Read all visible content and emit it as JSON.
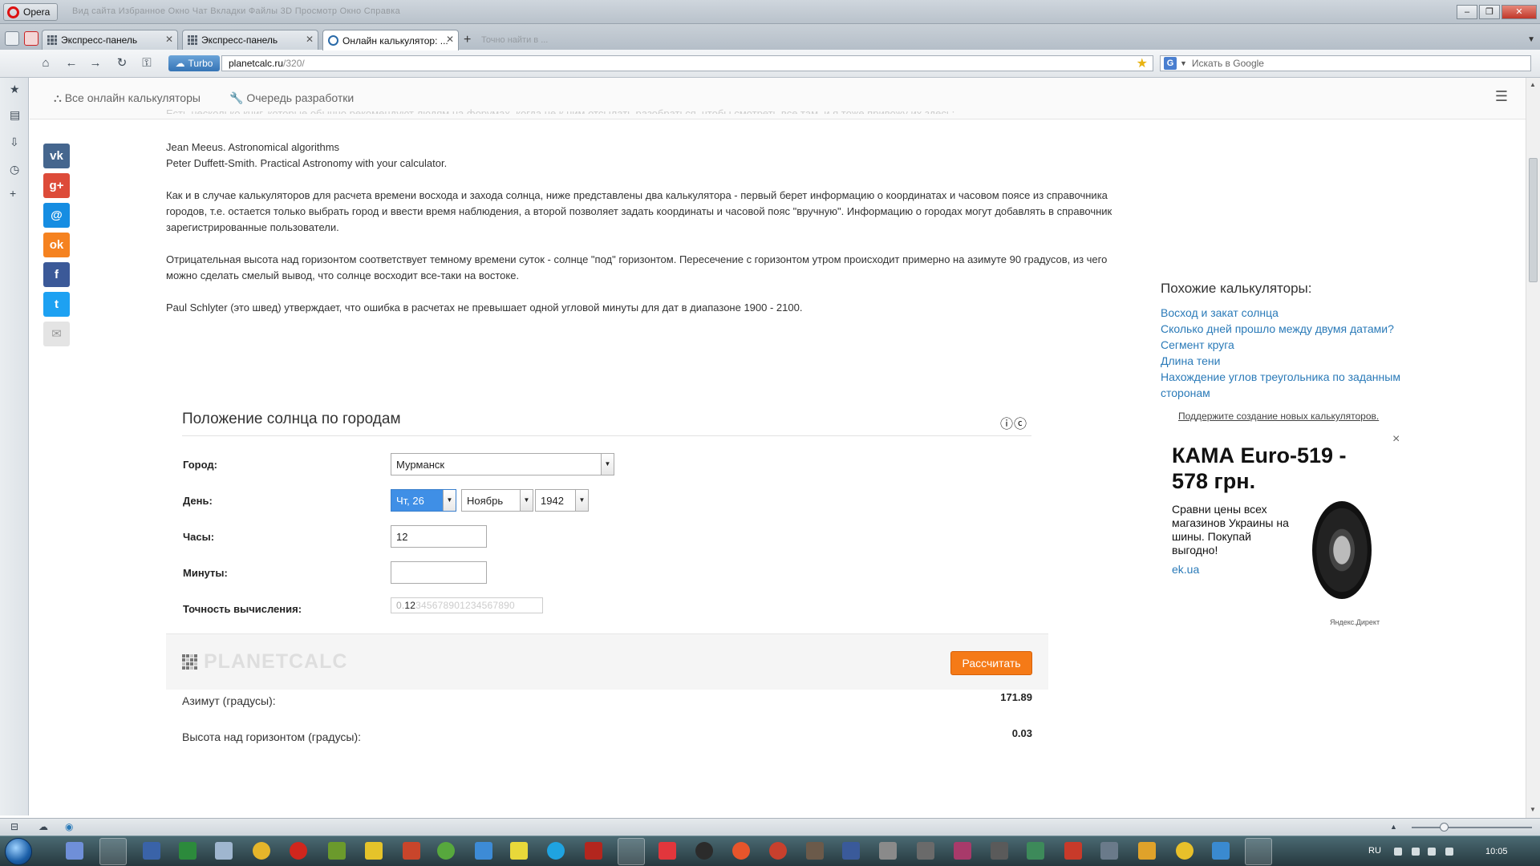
{
  "browser": {
    "menu_label": "Opera",
    "title_ghost": "Вид сайта   Избранное   Окно   Чат   Вкладки   Файлы   3D   Просмотр   Окно   Справка",
    "tabs": [
      {
        "label": "Экспресс-панель"
      },
      {
        "label": "Экспресс-панель"
      },
      {
        "label": "Онлайн калькулятор: ..."
      }
    ],
    "tab_ghost": "Точно найти в ...",
    "turbo_label": "Turbo",
    "address": {
      "host": "planetcalc.ru",
      "path": "/320/"
    },
    "search_placeholder": "Искать в Google",
    "search_engine": "G"
  },
  "site": {
    "nav": [
      {
        "label": "Все онлайн калькуляторы",
        "icon": "sitemap-icon"
      },
      {
        "label": "Очередь разработки",
        "icon": "wrench-icon"
      }
    ],
    "social": [
      {
        "name": "vk",
        "glyph": "vk",
        "color": "#45668e"
      },
      {
        "name": "google-plus",
        "glyph": "g+",
        "color": "#dd4b39"
      },
      {
        "name": "mailru",
        "glyph": "@",
        "color": "#168de2"
      },
      {
        "name": "odnoklassniki",
        "glyph": "ok",
        "color": "#f58220"
      },
      {
        "name": "facebook",
        "glyph": "f",
        "color": "#3b5998"
      },
      {
        "name": "twitter",
        "glyph": "t",
        "color": "#1da1f2"
      },
      {
        "name": "email",
        "glyph": "✉",
        "color": "#e4e4e4"
      }
    ]
  },
  "article": {
    "cut_line": "Есть несколько книг, которые обычно рекомендуют людям на форумах, когда не к ним отсылать разобраться, чтобы смотреть все там, и я тоже привожу их здесь:",
    "books": [
      "Jean Meeus. Astronomical algorithms",
      "Peter Duffett-Smith. Practical Astronomy with your calculator."
    ],
    "p1": "Как и в случае калькуляторов для расчета времени восхода и захода солнца, ниже представлены два калькулятора - первый берет информацию о координатах и часовом поясе из справочника городов, т.е. остается только выбрать город и ввести время наблюдения, а второй позволяет задать координаты и часовой пояс \"вручную\". Информацию о городах могут добавлять в справочник зарегистрированные пользователи.",
    "p2": "Отрицательная высота над горизонтом соответствует темному времени суток - солнце \"под\" горизонтом. Пересечение с горизонтом утром происходит примерно на азимуте 90 градусов, из чего можно сделать смелый вывод, что солнце восходит все-таки на востоке.",
    "p3": "Paul Schlyter (это швед) утверждает, что ошибка в расчетах не превышает одной угловой минуты для дат в диапазоне 1900 - 2100."
  },
  "calculator": {
    "title": "Положение солнца по городам",
    "license_icons": "ⓘⓒ",
    "city_label": "Город:",
    "city_value": "Мурманск",
    "day_label": "День:",
    "day_value": "Чт, 26",
    "month_value": "Ноябрь",
    "year_value": "1942",
    "hours_label": "Часы:",
    "hours_value": "12",
    "minutes_label": "Минуты:",
    "minutes_value": "",
    "precision_label": "Точность вычисления:",
    "precision_lead": "0.",
    "precision_selected": "12",
    "precision_rest": "345678901234567890",
    "brand": "PLANETCALC",
    "calc_button": "Рассчитать",
    "results": [
      {
        "label": "Азимут (градусы):",
        "value": "171.89"
      },
      {
        "label": "Высота над горизонтом (градусы):",
        "value": "0.03"
      }
    ]
  },
  "sidebar": {
    "similar_title": "Похожие калькуляторы:",
    "similar_links": [
      "Восход и закат солнца",
      "Сколько дней прошло между двумя датами?",
      "Сегмент круга",
      "Длина тени",
      "Нахождение углов треугольника по заданным сторонам"
    ],
    "support_link": "Поддержите создание новых калькуляторов."
  },
  "ad": {
    "title": "КАМА Euro-519 - 578 грн.",
    "description": "Сравни цены всех магазинов Украины на шины. Покупай выгодно!",
    "domain": "ek.ua",
    "provider": "Яндекс.Директ",
    "close_glyph": "×"
  },
  "taskbar": {
    "language": "RU",
    "time": "10:05"
  }
}
